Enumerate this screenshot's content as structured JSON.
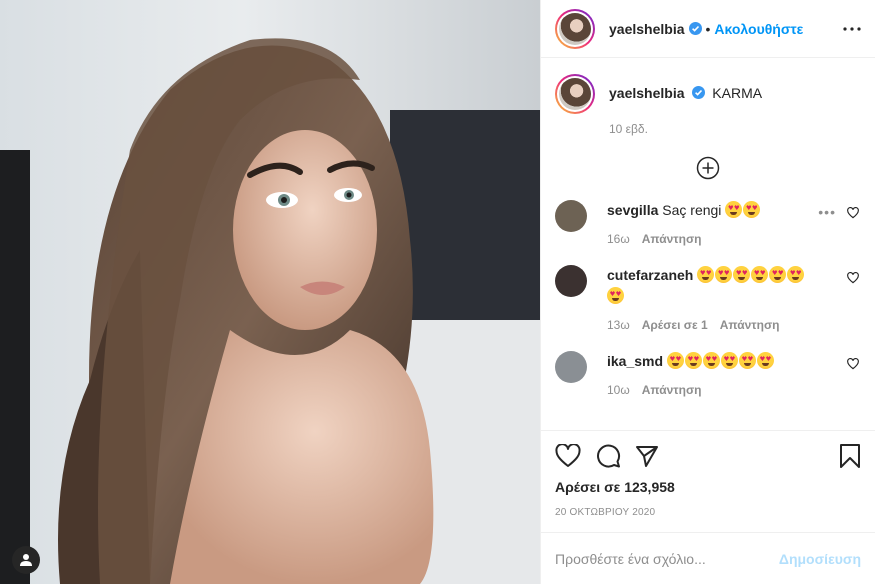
{
  "post": {
    "author": "yaelshelbia",
    "header": {
      "dot": "•",
      "follow_label": "Ακολουθήστε",
      "more_icon": "more-horizontal-icon"
    },
    "caption": {
      "username": "yaelshelbia",
      "text": "KARMA",
      "time": "10 εβδ."
    },
    "load_more_icon": "plus-circle-icon",
    "comments": [
      {
        "username": "sevgilla",
        "text": "Saç rengi",
        "emoji_count": 2,
        "time": "16ω",
        "likes": "",
        "reply": "Απάντηση",
        "avatar_color": "#6d6254"
      },
      {
        "username": "cutefarzaneh",
        "text": "",
        "emoji_count": 7,
        "time": "13ω",
        "likes": "Αρέσει σε 1",
        "reply": "Απάντηση",
        "avatar_color": "#3b3130"
      },
      {
        "username": "ika_smd",
        "text": "",
        "emoji_count": 6,
        "time": "10ω",
        "likes": "",
        "reply": "Απάντηση",
        "avatar_color": "#8a8f94"
      }
    ],
    "actions": {
      "like_icon": "heart-icon",
      "comment_icon": "comment-icon",
      "share_icon": "paper-plane-icon",
      "save_icon": "bookmark-icon"
    },
    "likes_label": "Αρέσει σε 123,958",
    "date": "20 ΟΚΤΩΒΡΙΟΥ 2020",
    "add_comment": {
      "placeholder": "Προσθέστε ένα σχόλιο...",
      "post_label": "Δημοσίευση"
    },
    "colors": {
      "accent": "#0095f6",
      "post_disabled": "#b2dffc",
      "muted": "#8e8e8e",
      "text": "#262626",
      "verified": "#3897f0"
    }
  }
}
